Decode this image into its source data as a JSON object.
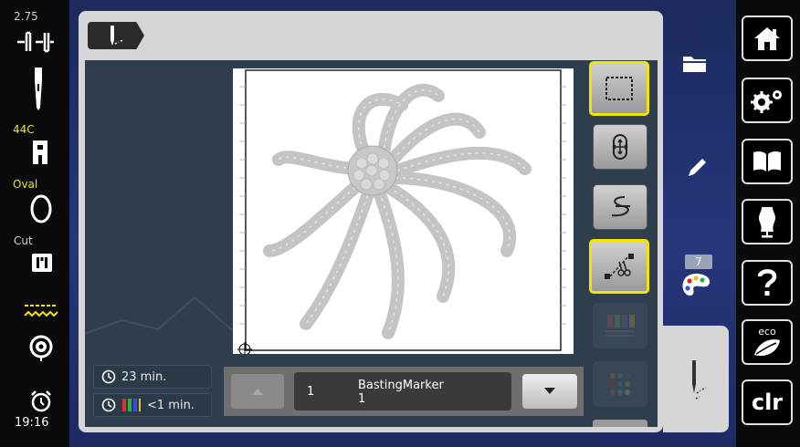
{
  "left_bar": {
    "needle_position": "2.75",
    "presser_foot": "44C",
    "hoop": "Oval",
    "cut_label": "Cut",
    "clock": "19:16"
  },
  "design": {
    "total_time": "23 min.",
    "color_time": "<1 min."
  },
  "color_info": {
    "index": "1",
    "name": "BastingMarker",
    "number": "1"
  },
  "colors_count": "7",
  "right_bar": {
    "eco_label": "eco",
    "clr_label": "clr"
  },
  "colors": {
    "accent": "#f2e600",
    "panel": "#d6d6d6",
    "content": "#2e3e4e"
  }
}
